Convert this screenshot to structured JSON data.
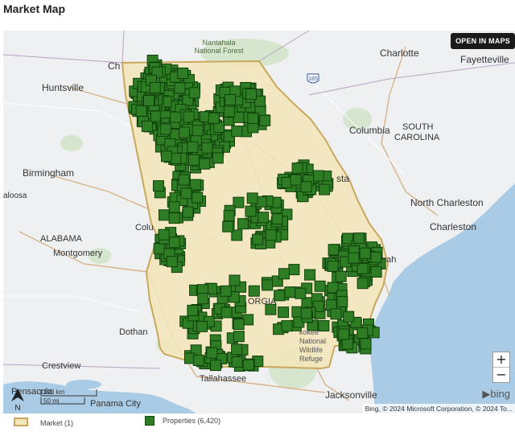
{
  "page": {
    "title": "Market Map"
  },
  "map": {
    "open_button": "OPEN IN MAPS",
    "zoom_in": "+",
    "zoom_out": "−",
    "north": "N",
    "scale_km": "100 km",
    "scale_mi": "50 mi",
    "provider": "bing",
    "attribution": "Bing, © 2024 Microsoft Corporation, © 2024 To...",
    "labels": {
      "chattanooga": "Ch",
      "nantahala": "Nantahala\nNational Forest",
      "charlotte": "Charlotte",
      "fayetteville": "Fayetteville",
      "huntsville": "Huntsville",
      "columbia": "Columbia",
      "south_carolina": "SOUTH\nCAROLINA",
      "birmingham": "Birmingham",
      "tuscaloosa": "aloosa",
      "augusta": "sta",
      "north_charleston": "North Charleston",
      "charleston": "Charleston",
      "alabama": "ALABAMA",
      "montgomery": "Montgomery",
      "columbus": "Colu",
      "savannah": "nah",
      "georgia": "ORGIA",
      "dothan": "Dothan",
      "okefenokee": "kokee\nNational\nWildlife\nRefuge",
      "crestview": "Crestview",
      "pensacola": "Pensacola",
      "panama_city": "Panama City",
      "tallahassee": "Tallahassee",
      "jacksonville": "Jacksonville",
      "hwy": "185"
    },
    "colors": {
      "water": "#a9cbe6",
      "land": "#eef0f2",
      "market_fill": "#f3e5ba",
      "market_border": "#c9a85d",
      "property": "#2e7d24",
      "property_border": "#0e3f0a"
    }
  },
  "legend": {
    "market_label": "Market (1)",
    "properties_label": "Properties (6,420)"
  }
}
